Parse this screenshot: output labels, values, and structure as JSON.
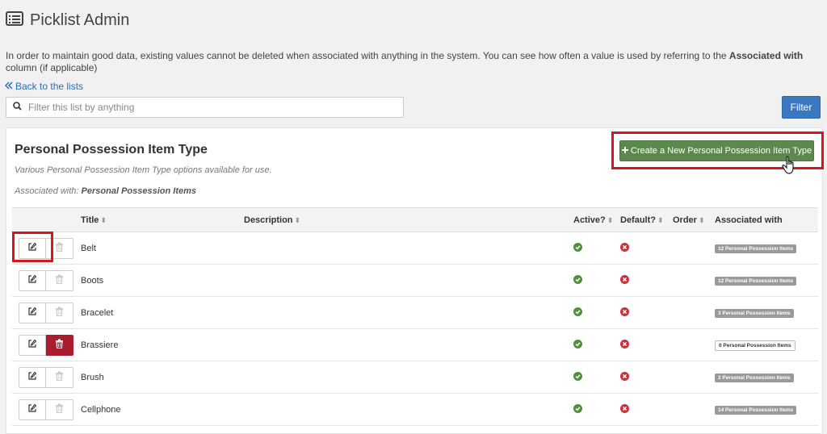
{
  "page": {
    "title": "Picklist Admin",
    "intro_text": "In order to maintain good data, existing values cannot be deleted when associated with anything in the system. You can see how often a value is used by referring to the ",
    "intro_bold": "Associated with",
    "intro_suffix": " column (if applicable)",
    "back_link": "Back to the lists"
  },
  "filter": {
    "placeholder": "Filter this list by anything",
    "button_label": "Filter"
  },
  "panel": {
    "title": "Personal Possession Item Type",
    "description": "Various Personal Possession Item Type options available for use.",
    "associated_prefix": "Associated with: ",
    "associated_value": "Personal Possession Items",
    "create_button": "Create a New Personal Possession Item Type"
  },
  "table": {
    "columns": {
      "title": "Title",
      "description": "Description",
      "active": "Active?",
      "default": "Default?",
      "order": "Order",
      "associated": "Associated with"
    },
    "rows": [
      {
        "title": "Belt",
        "active": true,
        "default": false,
        "associated": "12 Personal Possession Items",
        "deletable": false
      },
      {
        "title": "Boots",
        "active": true,
        "default": false,
        "associated": "12 Personal Possession Items",
        "deletable": false
      },
      {
        "title": "Bracelet",
        "active": true,
        "default": false,
        "associated": "3 Personal Possession Items",
        "deletable": false
      },
      {
        "title": "Brassiere",
        "active": true,
        "default": false,
        "associated": "0 Personal Possession Items",
        "deletable": true
      },
      {
        "title": "Brush",
        "active": true,
        "default": false,
        "associated": "2 Personal Possession Items",
        "deletable": false
      },
      {
        "title": "Cellphone",
        "active": true,
        "default": false,
        "associated": "14 Personal Possession Items",
        "deletable": false
      }
    ]
  },
  "colors": {
    "accent_blue": "#3a78c2",
    "create_green": "#5b8a4c",
    "highlight_red": "#d8141e",
    "danger": "#a91d2f"
  }
}
